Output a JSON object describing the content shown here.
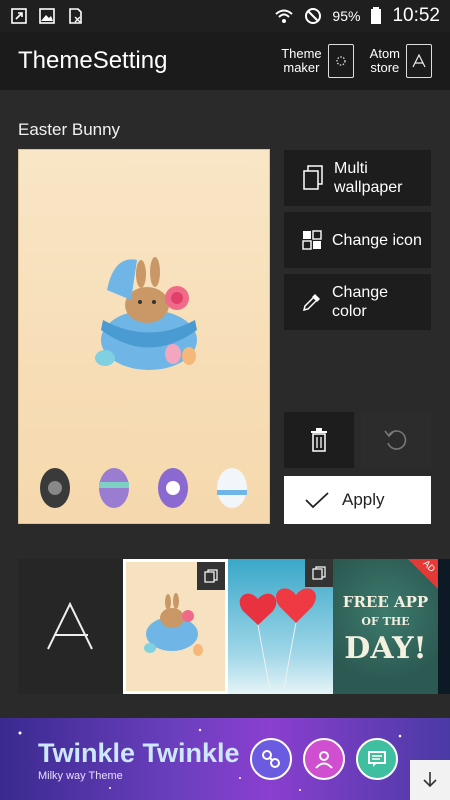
{
  "status_bar": {
    "battery_percent": "95%",
    "time": "10:52",
    "icons": [
      "screenshot-icon",
      "image-icon",
      "sim-icon",
      "wifi-icon",
      "do-not-disturb-icon",
      "battery-icon"
    ]
  },
  "header": {
    "title": "ThemeSetting",
    "theme_maker_label_line1": "Theme",
    "theme_maker_label_line2": "maker",
    "atom_store_label_line1": "Atom",
    "atom_store_label_line2": "store"
  },
  "theme": {
    "name": "Easter Bunny"
  },
  "actions": {
    "multi_wallpaper_line1": "Multi",
    "multi_wallpaper_line2": "wallpaper",
    "change_icon": "Change icon",
    "change_color_line1": "Change",
    "change_color_line2": "color",
    "apply": "Apply"
  },
  "thumbnails": {
    "ad_line1": "FREE APP",
    "ad_line2": "OF THE",
    "ad_line3": "DAY!",
    "ad_badge": "AD"
  },
  "banner": {
    "title": "Twinkle Twinkle",
    "subtitle": "Milky way Theme"
  },
  "colors": {
    "background": "#2a2a2a",
    "header": "#1b1b1b",
    "button": "#1d1d1d",
    "apply": "#ffffff",
    "ad_badge": "#e53935"
  }
}
